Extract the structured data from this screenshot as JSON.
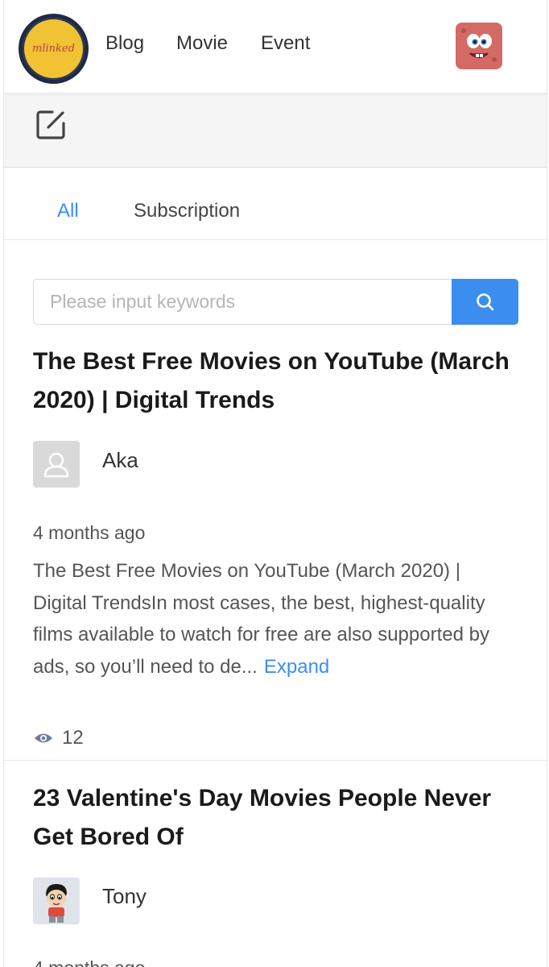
{
  "header": {
    "logo_text": "mlinked",
    "nav": [
      "Blog",
      "Movie",
      "Event"
    ]
  },
  "toolbar": {
    "edit_icon": "edit-square-icon"
  },
  "tabs": [
    {
      "label": "All",
      "active": true
    },
    {
      "label": "Subscription",
      "active": false
    }
  ],
  "search": {
    "placeholder": "Please input keywords",
    "value": "",
    "button_icon": "search-icon"
  },
  "articles": [
    {
      "title": "The Best Free Movies on YouTube (March 2020) | Digital Trends",
      "author": "Aka",
      "time": "4 months ago",
      "excerpt": "The Best Free Movies on YouTube (March 2020) | Digital TrendsIn most cases, the best, highest-quality films available to watch for free are also supported by ads, so you’ll need to de...",
      "expand_label": "Expand",
      "views": "12"
    },
    {
      "title": "23 Valentine's Day Movies People Never Get Bored Of",
      "author": "Tony",
      "time": "4 months ago"
    }
  ],
  "colors": {
    "accent": "#3b8ef0",
    "toolbar_bg": "#f5f5f5"
  }
}
